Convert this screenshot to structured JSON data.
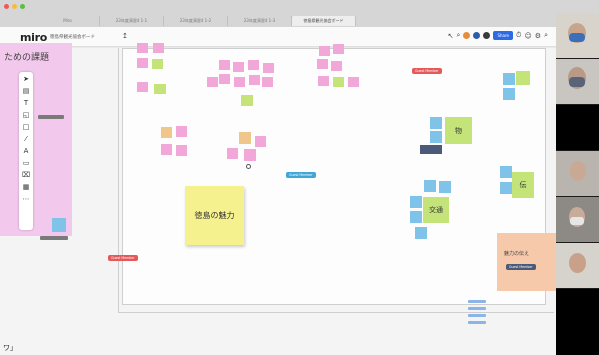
{
  "browser": {
    "tabs": [
      "Miro",
      "23年度演習4 1-1",
      "23年度演習4 1-2",
      "23年度演習4 1-3",
      "徳島県観光協会ボード"
    ]
  },
  "miro": {
    "logo": "miro",
    "board_title": "徳島県観光協会ボード",
    "upload_icon": "↥",
    "share_label": "Share",
    "toolbar_icons": [
      "cursor-icon",
      "sticky-note-icon",
      "text-icon",
      "shape-icon",
      "frame-icon",
      "pen-icon",
      "type-icon",
      "comment-icon",
      "crop-icon",
      "grid-icon",
      "more-icon"
    ]
  },
  "board": {
    "left_frame_title": "ための課題",
    "main_sticky": "徳島の魅力",
    "green_note_1": "物",
    "green_note_2": "交通",
    "green_note_3": "伝",
    "peach_label": "魅力の伝え",
    "bottom_left_text": "ワ」",
    "cursor_labels": [
      "Guest Member",
      "Guest Member",
      "Guest Member",
      "Guest Member",
      "Guest Member",
      "Guest Member"
    ]
  },
  "colors": {
    "pink_note": "#f1a7d8",
    "blue_note": "#7fc4e8",
    "orange_note": "#f0c78a",
    "green_note": "#c4e47a",
    "yellow_note": "#f5f18f"
  }
}
